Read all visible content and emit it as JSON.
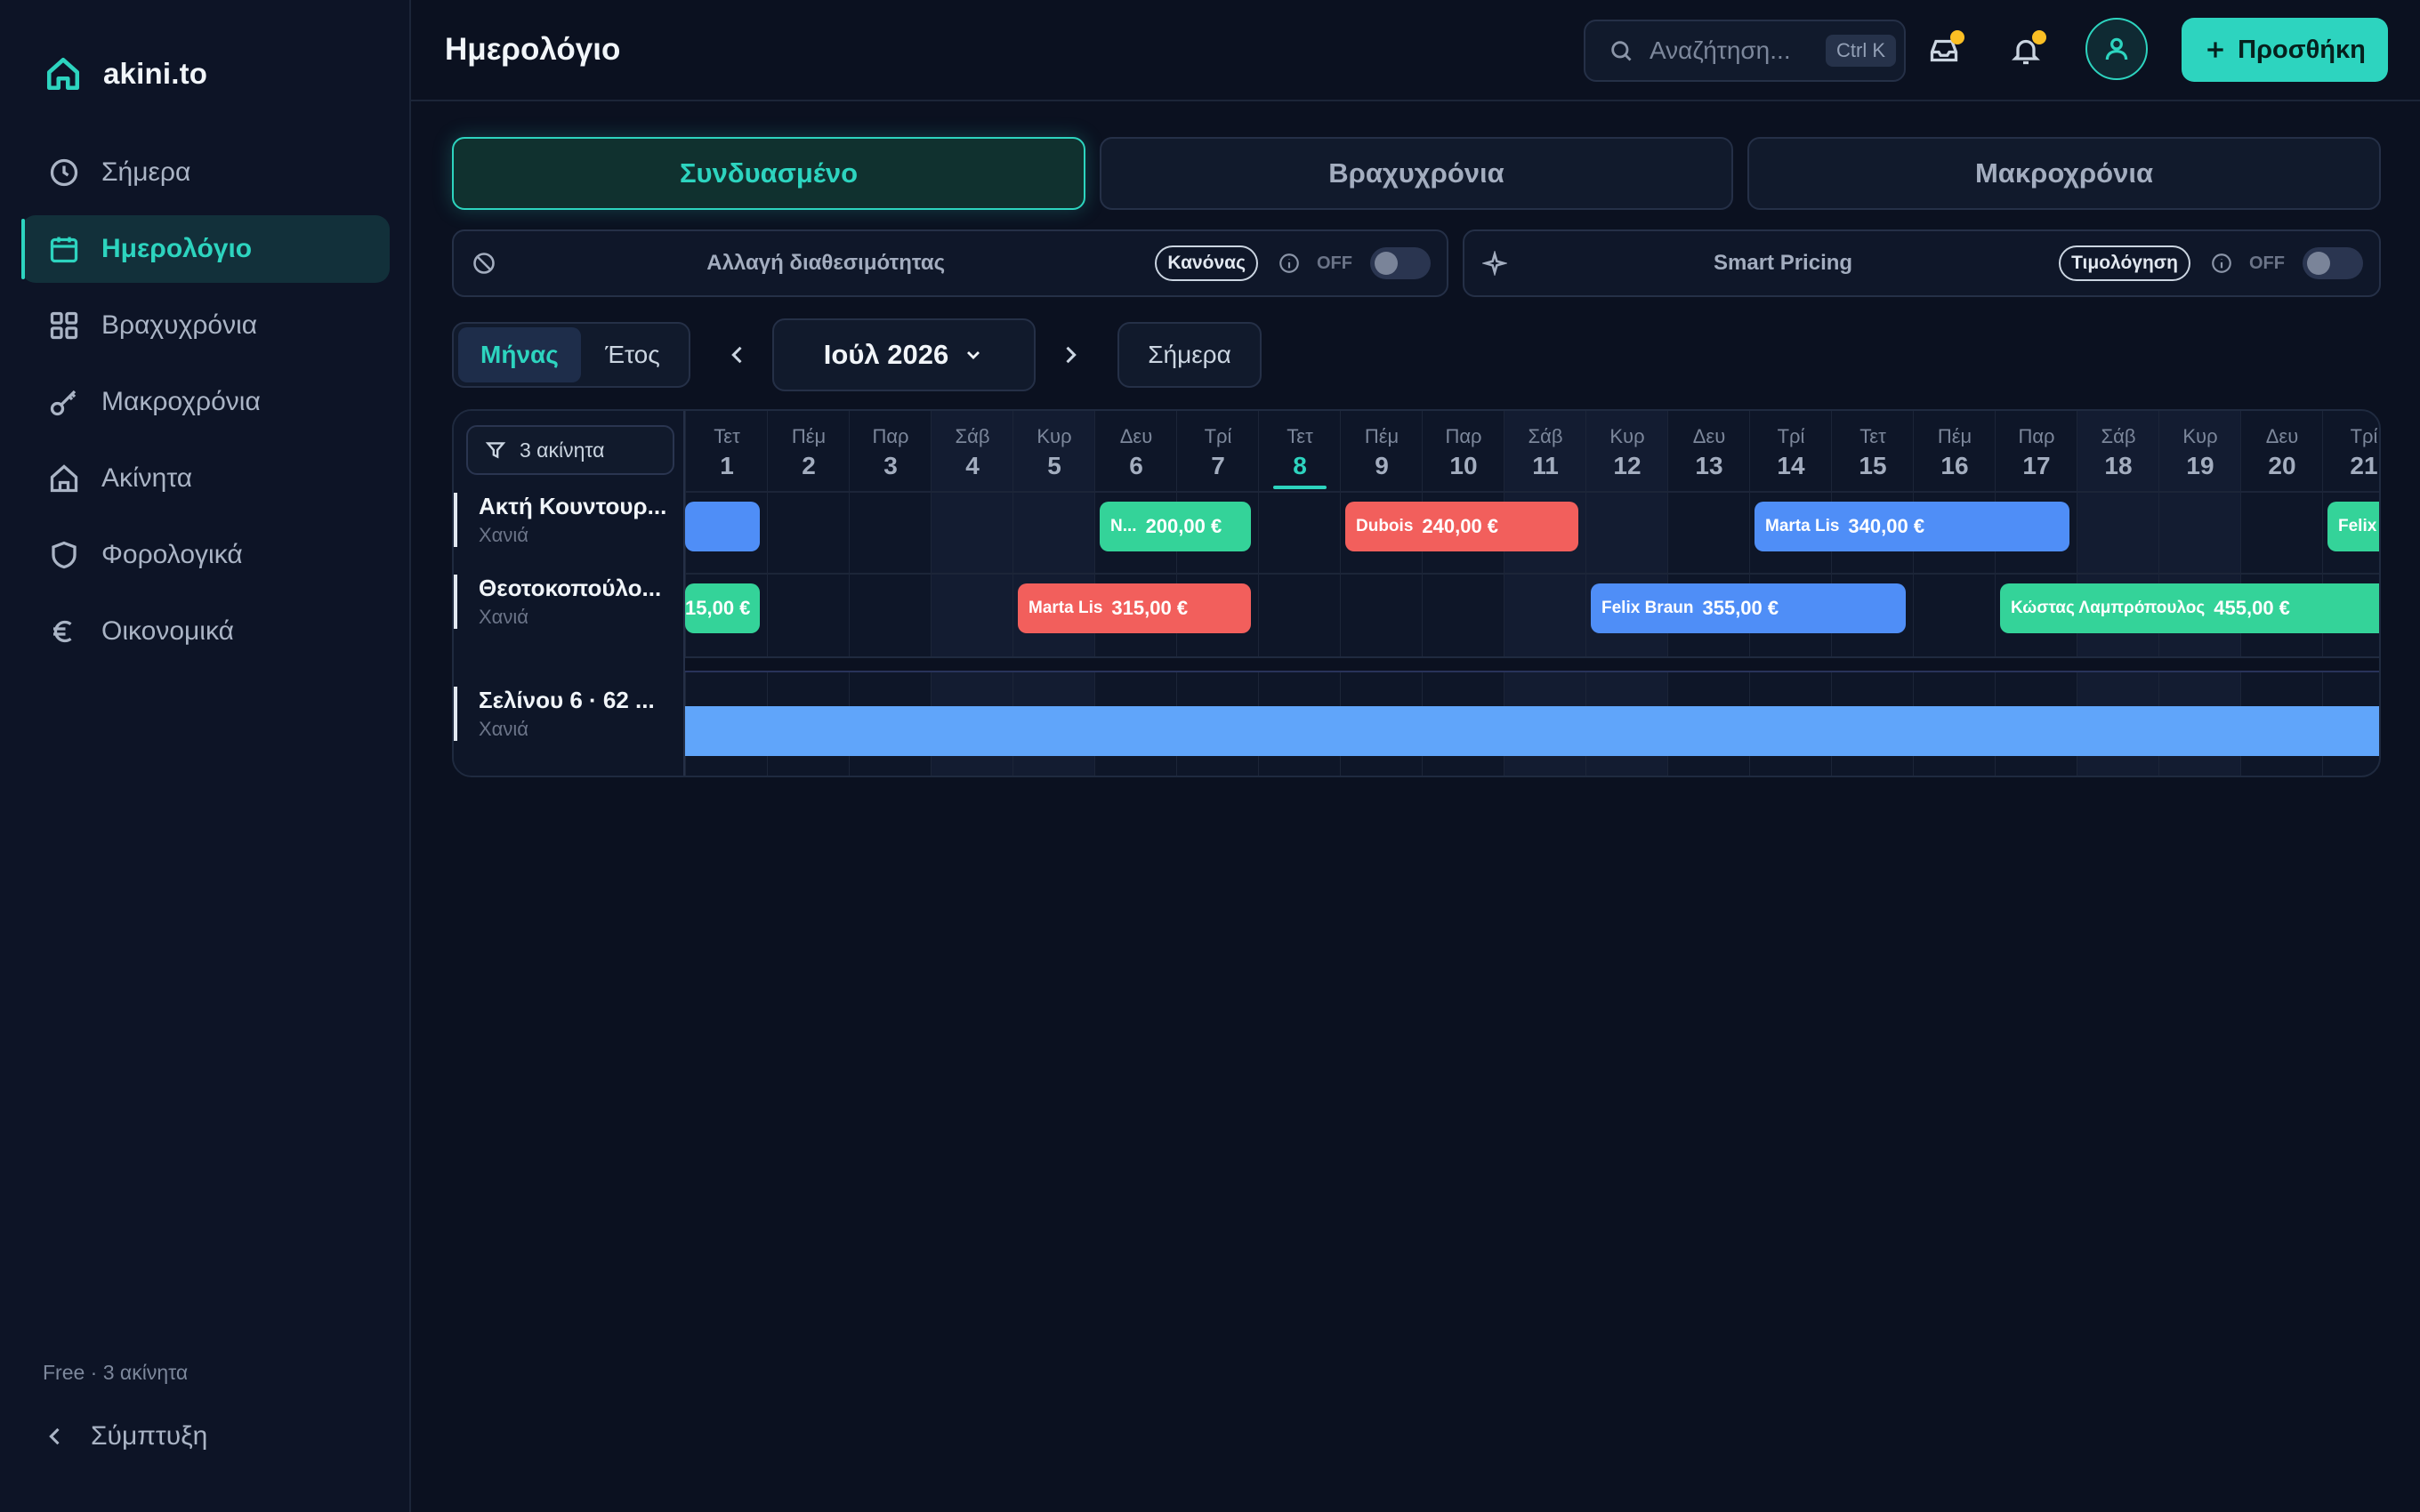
{
  "brand": {
    "name": "akini.to"
  },
  "sidebar": {
    "items": [
      {
        "label": "Σήμερα",
        "icon": "clock-icon"
      },
      {
        "label": "Ημερολόγιο",
        "icon": "calendar-icon",
        "active": true
      },
      {
        "label": "Βραχυχρόνια",
        "icon": "grid-icon"
      },
      {
        "label": "Μακροχρόνια",
        "icon": "key-icon"
      },
      {
        "label": "Ακίνητα",
        "icon": "home-icon"
      },
      {
        "label": "Φορολογικά",
        "icon": "shield-icon"
      },
      {
        "label": "Οικονομικά",
        "icon": "euro-icon"
      }
    ],
    "plan": "Free · 3 ακίνητα",
    "collapse_label": "Σύμπτυξη"
  },
  "header": {
    "title": "Ημερολόγιο",
    "search_placeholder": "Αναζήτηση...",
    "search_shortcut": "Ctrl K",
    "add_label": "Προσθήκη"
  },
  "tabs": [
    {
      "label": "Συνδυασμένο",
      "active": true
    },
    {
      "label": "Βραχυχρόνια",
      "active": false
    },
    {
      "label": "Μακροχρόνια",
      "active": false
    }
  ],
  "toggles": {
    "availability": {
      "label": "Αλλαγή διαθεσιμότητας",
      "pill": "Κανόνας",
      "state": "OFF"
    },
    "pricing": {
      "label": "Smart Pricing",
      "pill": "Τιμολόγηση",
      "state": "OFF"
    }
  },
  "view": {
    "modes": [
      "Μήνας",
      "Έτος"
    ],
    "active_mode": "Μήνας",
    "month_label": "Ιούλ 2026",
    "today_label": "Σήμερα"
  },
  "calendar": {
    "filter_label": "3 ακίνητα",
    "today_day": 8,
    "days": [
      {
        "dow": "Τετ",
        "dom": "1"
      },
      {
        "dow": "Πέμ",
        "dom": "2"
      },
      {
        "dow": "Παρ",
        "dom": "3"
      },
      {
        "dow": "Σάβ",
        "dom": "4"
      },
      {
        "dow": "Κυρ",
        "dom": "5"
      },
      {
        "dow": "Δευ",
        "dom": "6"
      },
      {
        "dow": "Τρί",
        "dom": "7"
      },
      {
        "dow": "Τετ",
        "dom": "8"
      },
      {
        "dow": "Πέμ",
        "dom": "9"
      },
      {
        "dow": "Παρ",
        "dom": "10"
      },
      {
        "dow": "Σάβ",
        "dom": "11"
      },
      {
        "dow": "Κυρ",
        "dom": "12"
      },
      {
        "dow": "Δευ",
        "dom": "13"
      },
      {
        "dow": "Τρί",
        "dom": "14"
      },
      {
        "dow": "Τετ",
        "dom": "15"
      },
      {
        "dow": "Πέμ",
        "dom": "16"
      },
      {
        "dow": "Παρ",
        "dom": "17"
      },
      {
        "dow": "Σάβ",
        "dom": "18"
      },
      {
        "dow": "Κυρ",
        "dom": "19"
      },
      {
        "dow": "Δευ",
        "dom": "20"
      },
      {
        "dow": "Τρί",
        "dom": "21"
      }
    ],
    "properties": [
      {
        "name": "Ακτή Κουντουρ...",
        "city": "Χανιά",
        "bookings": [
          {
            "guest": "",
            "price": "",
            "color": "blue"
          },
          {
            "guest": "N...",
            "price": "200,00 €",
            "color": "green"
          },
          {
            "guest": "Dubois",
            "price": "240,00 €",
            "color": "red"
          },
          {
            "guest": "Marta Lis",
            "price": "340,00 €",
            "color": "blue"
          },
          {
            "guest": "Felix",
            "price": "",
            "color": "green"
          }
        ]
      },
      {
        "name": "Θεοτοκοπούλο...",
        "city": "Χανιά",
        "bookings": [
          {
            "guest": "",
            "price": "15,00 €",
            "color": "green"
          },
          {
            "guest": "Marta Lis",
            "price": "315,00 €",
            "color": "red"
          },
          {
            "guest": "Felix Braun",
            "price": "355,00 €",
            "color": "blue"
          },
          {
            "guest": "Κώστας Λαμπρόπουλος",
            "price": "455,00 €",
            "color": "green"
          }
        ]
      },
      {
        "name": "Σελίνου 6 · 62 ...",
        "city": "Χανιά",
        "bookings": [
          {
            "guest": "",
            "price": "",
            "color": "lightblue"
          }
        ]
      }
    ]
  }
}
